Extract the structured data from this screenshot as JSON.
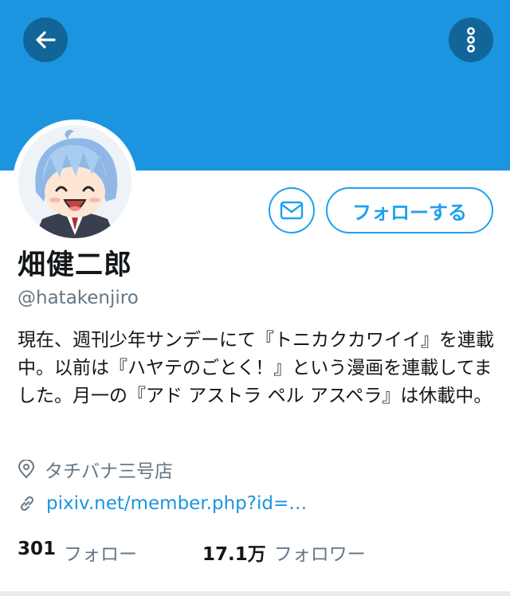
{
  "banner": {
    "color": "#1b95e0"
  },
  "header": {
    "back_icon": "arrow-left-icon",
    "more_icon": "more-vertical-icon"
  },
  "profile": {
    "name": "畑健二郎",
    "handle": "@hatakenjiro",
    "bio": "現在、週刊少年サンデーにて『トニカクカワイイ』を連載中。以前は『ハヤテのごとく！』という漫画を連載してました。月一の『アド アストラ ペル アスペラ』は休載中。",
    "location": "タチバナ三号店",
    "website": "pixiv.net/member.php?id=…"
  },
  "actions": {
    "message_icon": "envelope-icon",
    "follow_label": "フォローする"
  },
  "stats": {
    "following_count": "301",
    "following_label": "フォロー",
    "followers_count": "17.1万",
    "followers_label": "フォロワー"
  },
  "colors": {
    "accent": "#1da1f2",
    "text": "#14171a",
    "muted": "#657786"
  }
}
